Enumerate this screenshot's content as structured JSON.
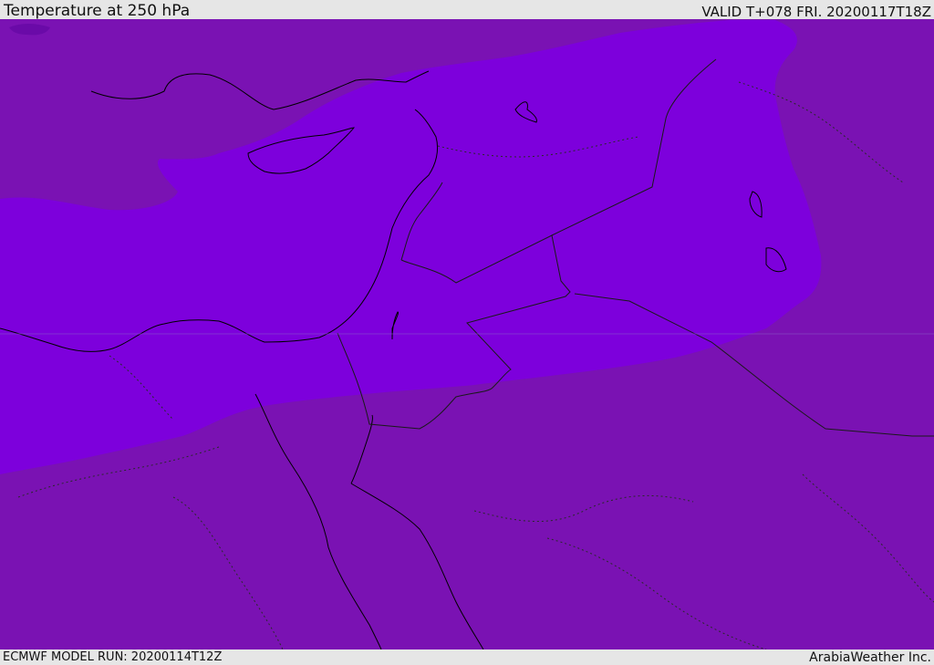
{
  "header": {
    "title": "Temperature at 250 hPa",
    "valid": "VALID T+078 FRI. 20200117T18Z"
  },
  "footer": {
    "model_run": "ECMWF MODEL RUN: 20200114T12Z",
    "credit": "ArabiaWeather Inc."
  },
  "map": {
    "colors": {
      "outer_band": "#7a12b3",
      "inner_band": "#7d00dc",
      "cold_spot": "#6a0aa8",
      "coastline": "#000000",
      "border": "#1a1a1a"
    }
  }
}
